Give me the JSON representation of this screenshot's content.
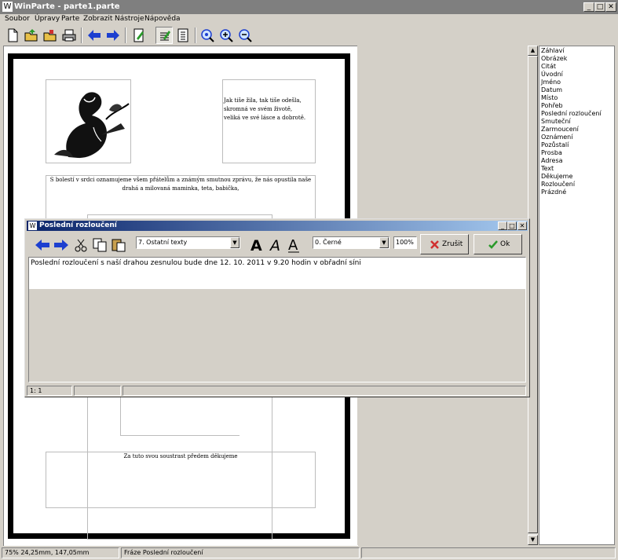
{
  "app": {
    "title": "WinParte - parte1.parte",
    "window_controls": {
      "minimize": "_",
      "maximize": "□",
      "close": "✕"
    }
  },
  "menu": [
    "Soubor",
    "Úpravy",
    "Parte",
    "Zobrazit",
    "Nástroje",
    "Nápověda"
  ],
  "toolbar_icons": [
    "new-document-icon",
    "open-folder-icon",
    "open-file-icon",
    "print-icon",
    "back-arrow-icon",
    "forward-arrow-icon",
    "edit-icon",
    "text-edit-icon",
    "page-icon",
    "zoom-fit-icon",
    "zoom-in-icon",
    "zoom-out-icon"
  ],
  "page": {
    "poem": [
      "Jak tiše žila, tak tiše odešla,",
      "skromná ve svém životě,",
      "veliká ve své lásce a dobrotě."
    ],
    "announcement": [
      "S bolestí v srdci oznamujeme všem přátelům a známým smutnou zprávu, že nás opustila naše",
      "drahá a milovaná maminka, teta, babička,"
    ],
    "closing": "Za tuto svou soustrast předem děkujeme"
  },
  "list_items": [
    "Záhlaví",
    "Obrázek",
    "Citát",
    "Úvodní",
    "Jméno",
    "Datum",
    "Místo",
    "Pohřeb",
    "Poslední rozloučení",
    "Smuteční",
    "Zarmoucení",
    "Oznámení",
    "Pozůstalí",
    "Prosba",
    "Adresa",
    "Text",
    "Děkujeme",
    "Rozloučení",
    "Prázdné"
  ],
  "status_bar": {
    "zoom_pos": "75% 24,25mm, 147,05mm",
    "field": "Fráze Poslední rozloučení"
  },
  "dialog": {
    "title": "Poslední rozloučení",
    "category": "7. Ostatní texty",
    "color": "0. Černé",
    "zoom": "100%",
    "cancel_label": "Zrušit",
    "ok_label": "Ok",
    "text": "Poslední rozloučení s naší drahou zesnulou bude dne 12. 10. 2011 v 9.20 hodin v obřadní síni",
    "status_pos": "1:  1"
  },
  "colors": {
    "accent": "#0a246a",
    "cancel_icon": "#d03030",
    "ok_icon": "#2a9a2a",
    "arrows": "#1c3fd0"
  }
}
